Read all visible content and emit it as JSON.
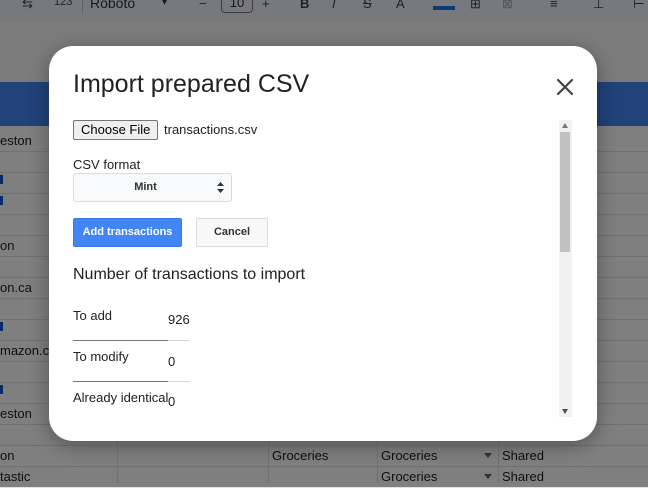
{
  "toolbar": {
    "zoom_partial": "123",
    "font_name": "Roboto",
    "font_size": "10"
  },
  "sheet": {
    "left_column": [
      {
        "text": "eston",
        "link": false
      },
      {
        "text": "",
        "link": false
      },
      {
        "text": "",
        "link": true
      },
      {
        "text": "",
        "link": true
      },
      {
        "text": "",
        "link": false
      },
      {
        "text": "on",
        "link": false
      },
      {
        "text": "",
        "link": false
      },
      {
        "text": "on.ca",
        "link": false
      },
      {
        "text": "",
        "link": false
      },
      {
        "text": "",
        "link": true
      },
      {
        "text": "mazon.c",
        "link": false
      },
      {
        "text": "",
        "link": false
      },
      {
        "text": "",
        "link": true
      },
      {
        "text": "eston",
        "link": false
      },
      {
        "text": "",
        "link": false
      },
      {
        "text": "on",
        "link": false
      },
      {
        "text": "tastic",
        "link": false
      }
    ],
    "bottom_rows": [
      {
        "category": "Groceries",
        "category2": "Groceries",
        "owner": "Shared"
      },
      {
        "category": "",
        "category2": "Groceries",
        "owner": "Shared"
      }
    ]
  },
  "dialog": {
    "title": "Import prepared CSV",
    "close_icon": "close-icon",
    "choose_file_label": "Choose File",
    "file_name": "transactions.csv",
    "csv_format_label": "CSV format",
    "csv_format_value": "Mint",
    "add_button": "Add transactions",
    "cancel_button": "Cancel",
    "section_title": "Number of transactions to import",
    "stats": [
      {
        "label": "To add",
        "value": "926"
      },
      {
        "label": "To modify",
        "value": "0"
      },
      {
        "label": "Already identical",
        "value": "0"
      }
    ],
    "accent_color": "#4285f4"
  }
}
